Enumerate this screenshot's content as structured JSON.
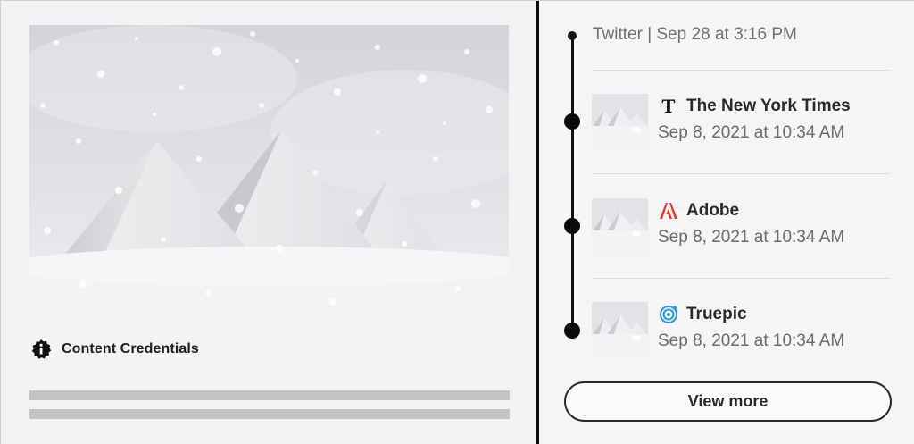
{
  "left_card": {
    "image_label": "Pyramids in snow",
    "credentials_label": "Content Credentials",
    "credentials_icon": "info-badge-icon"
  },
  "history": {
    "top_entry": "Twitter | Sep 28 at 3:16 PM",
    "entries": [
      {
        "source": "The New York Times",
        "icon": "nyt-logo-icon",
        "date": "Sep 8, 2021 at 10:34 AM"
      },
      {
        "source": "Adobe",
        "icon": "adobe-logo-icon",
        "date": "Sep 8, 2021 at 10:34 AM"
      },
      {
        "source": "Truepic",
        "icon": "truepic-logo-icon",
        "date": "Sep 8, 2021 at 10:34 AM"
      }
    ],
    "view_more_label": "View more"
  },
  "colors": {
    "adobe_red": "#e0362c",
    "truepic_blue": "#2b9ad8",
    "timeline": "#111111"
  }
}
